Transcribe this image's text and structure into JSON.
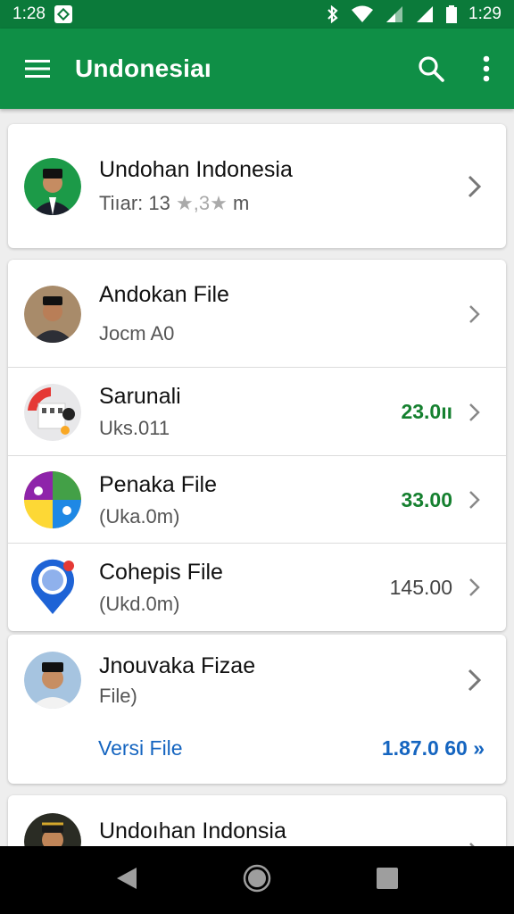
{
  "status_bar": {
    "time_left": "1:28",
    "time_right": "1:29"
  },
  "app_bar": {
    "title": "Undonesiaı"
  },
  "profile_card": {
    "title": "Undohan Indonesia",
    "subtitle_prefix": "Tiıar: 13",
    "subtitle_rating": "★,3★",
    "subtitle_suffix": "m"
  },
  "files": [
    {
      "title": "Andokan File",
      "subtitle": "Jocm A0",
      "amount": ""
    },
    {
      "title": "Sarunali",
      "subtitle": "Uks.011",
      "amount": "23.0ıı"
    },
    {
      "title": "Penaka File",
      "subtitle": "(Uka.0m)",
      "amount": "33.00"
    },
    {
      "title": "Cohepis File",
      "subtitle": "(Ukd.0m)",
      "amount": "145.00"
    }
  ],
  "version_card": {
    "title": "Jnouvaka Fizae",
    "subtitle": "File)",
    "link_label": "Versi File",
    "link_value": "1.87.0 60 »"
  },
  "bottom_card": {
    "title": "Undoıhan Indonsia"
  },
  "colors": {
    "primary": "#0f8f46",
    "status": "#0b7a3a",
    "accent_green": "#15802f",
    "link_blue": "#1565c0"
  }
}
